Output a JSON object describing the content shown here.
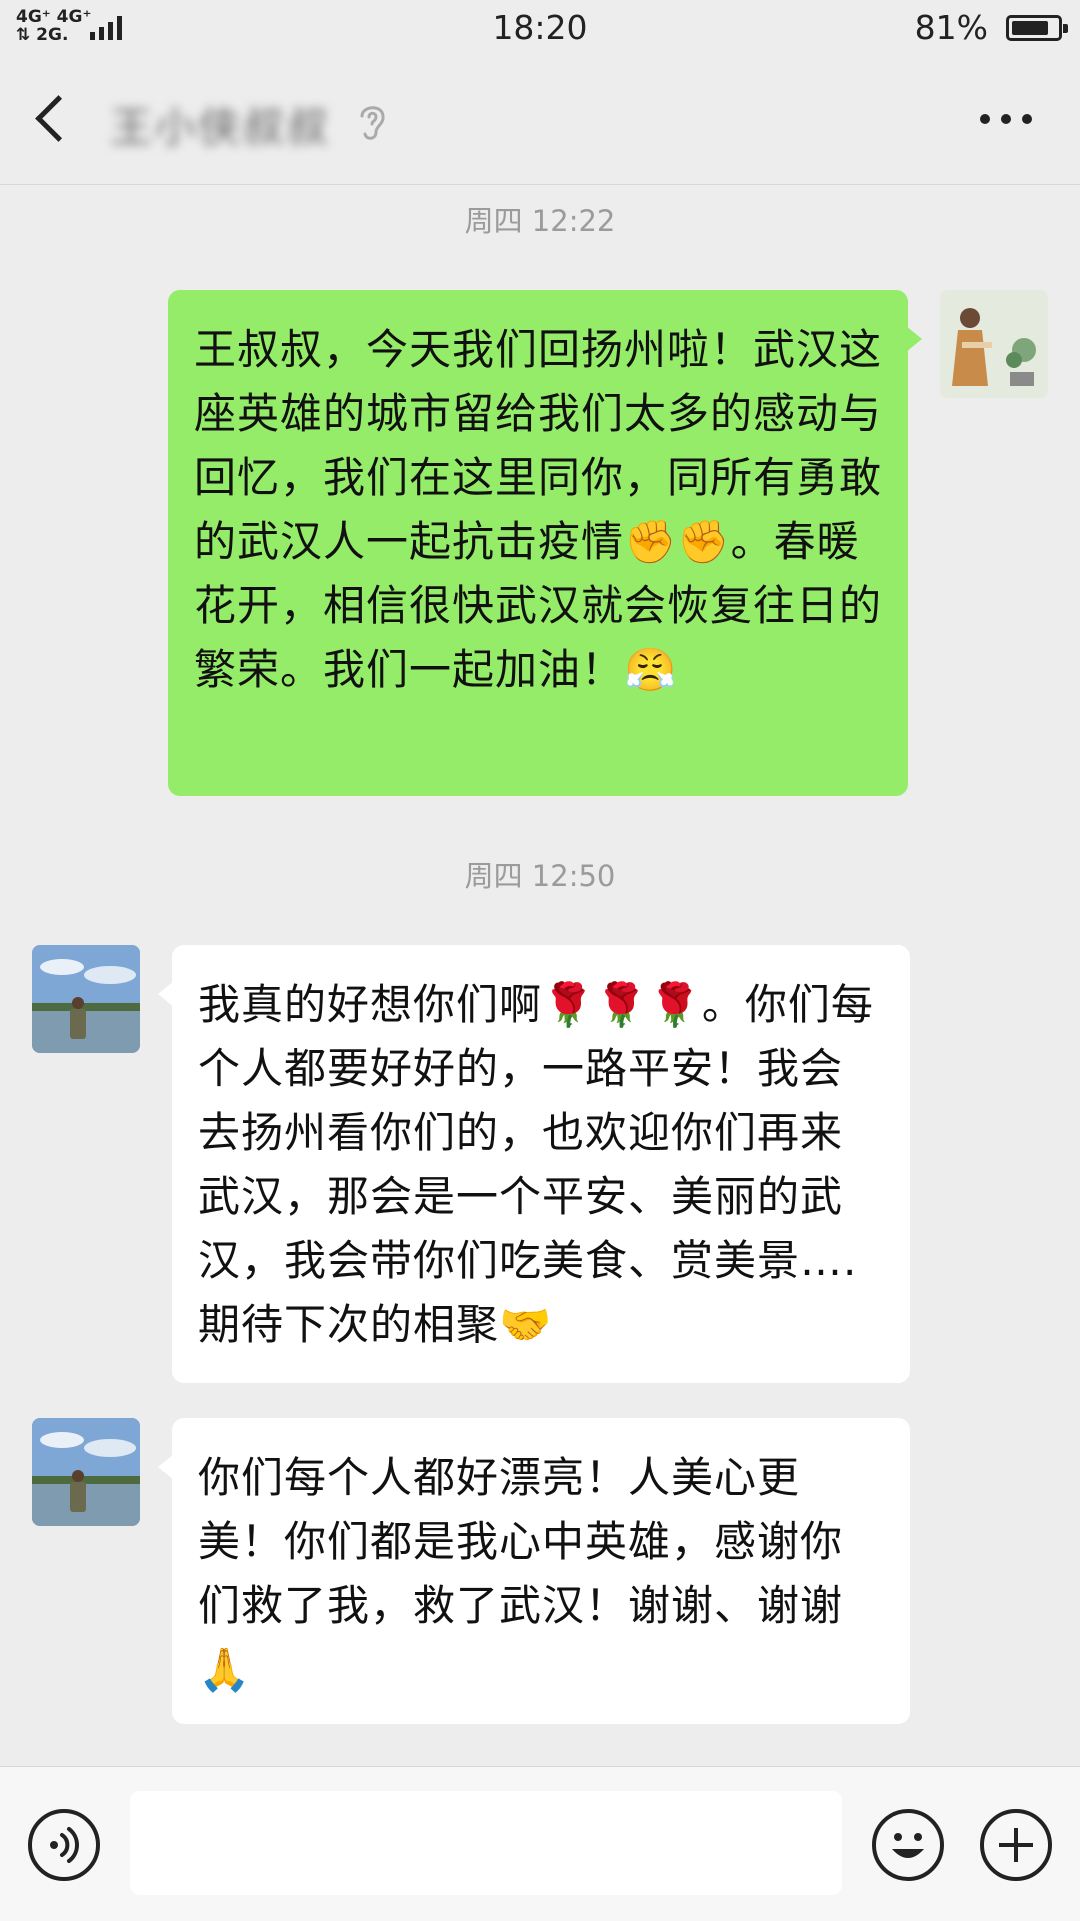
{
  "status_bar": {
    "network_line1": "4G⁺ 4G⁺",
    "network_line2": "⇅ 2G.",
    "time": "18:20",
    "battery_percent": "81%",
    "battery_level": 0.81
  },
  "header": {
    "contact_name": "王小侠叔叔",
    "contact_name_blurred": true,
    "icons": {
      "back": "back-arrow-icon",
      "ear": "ear-icon",
      "more": "more-icon"
    }
  },
  "messages": [
    {
      "type": "timestamp",
      "text": "周四 12:22"
    },
    {
      "type": "message",
      "from": "me",
      "text": "王叔叔，今天我们回扬州啦！武汉这座英雄的城市留给我们太多的感动与回忆，我们在这里同你，同所有勇敢的武汉人一起抗击疫情✊✊。春暖花开，相信很快武汉就会恢复往日的繁荣。我们一起加油！😤"
    },
    {
      "type": "timestamp",
      "text": "周四 12:50"
    },
    {
      "type": "message",
      "from": "other",
      "text": "我真的好想你们啊🌹🌹🌹。你们每个人都要好好的，一路平安！我会去扬州看你们的，也欢迎你们再来武汉，那会是一个平安、美丽的武汉，我会带你们吃美食、赏美景….期待下次的相聚🤝"
    },
    {
      "type": "message",
      "from": "other",
      "text": "你们每个人都好漂亮！人美心更美！你们都是我心中英雄，感谢你们救了我，救了武汉！谢谢、谢谢🙏"
    }
  ],
  "input_bar": {
    "placeholder": "",
    "icons": {
      "voice": "voice-icon",
      "emoji": "emoji-icon",
      "plus": "plus-icon"
    }
  },
  "colors": {
    "background": "#ededed",
    "my_bubble": "#95ec69",
    "other_bubble": "#ffffff",
    "timestamp_text": "#9b9b9b"
  }
}
